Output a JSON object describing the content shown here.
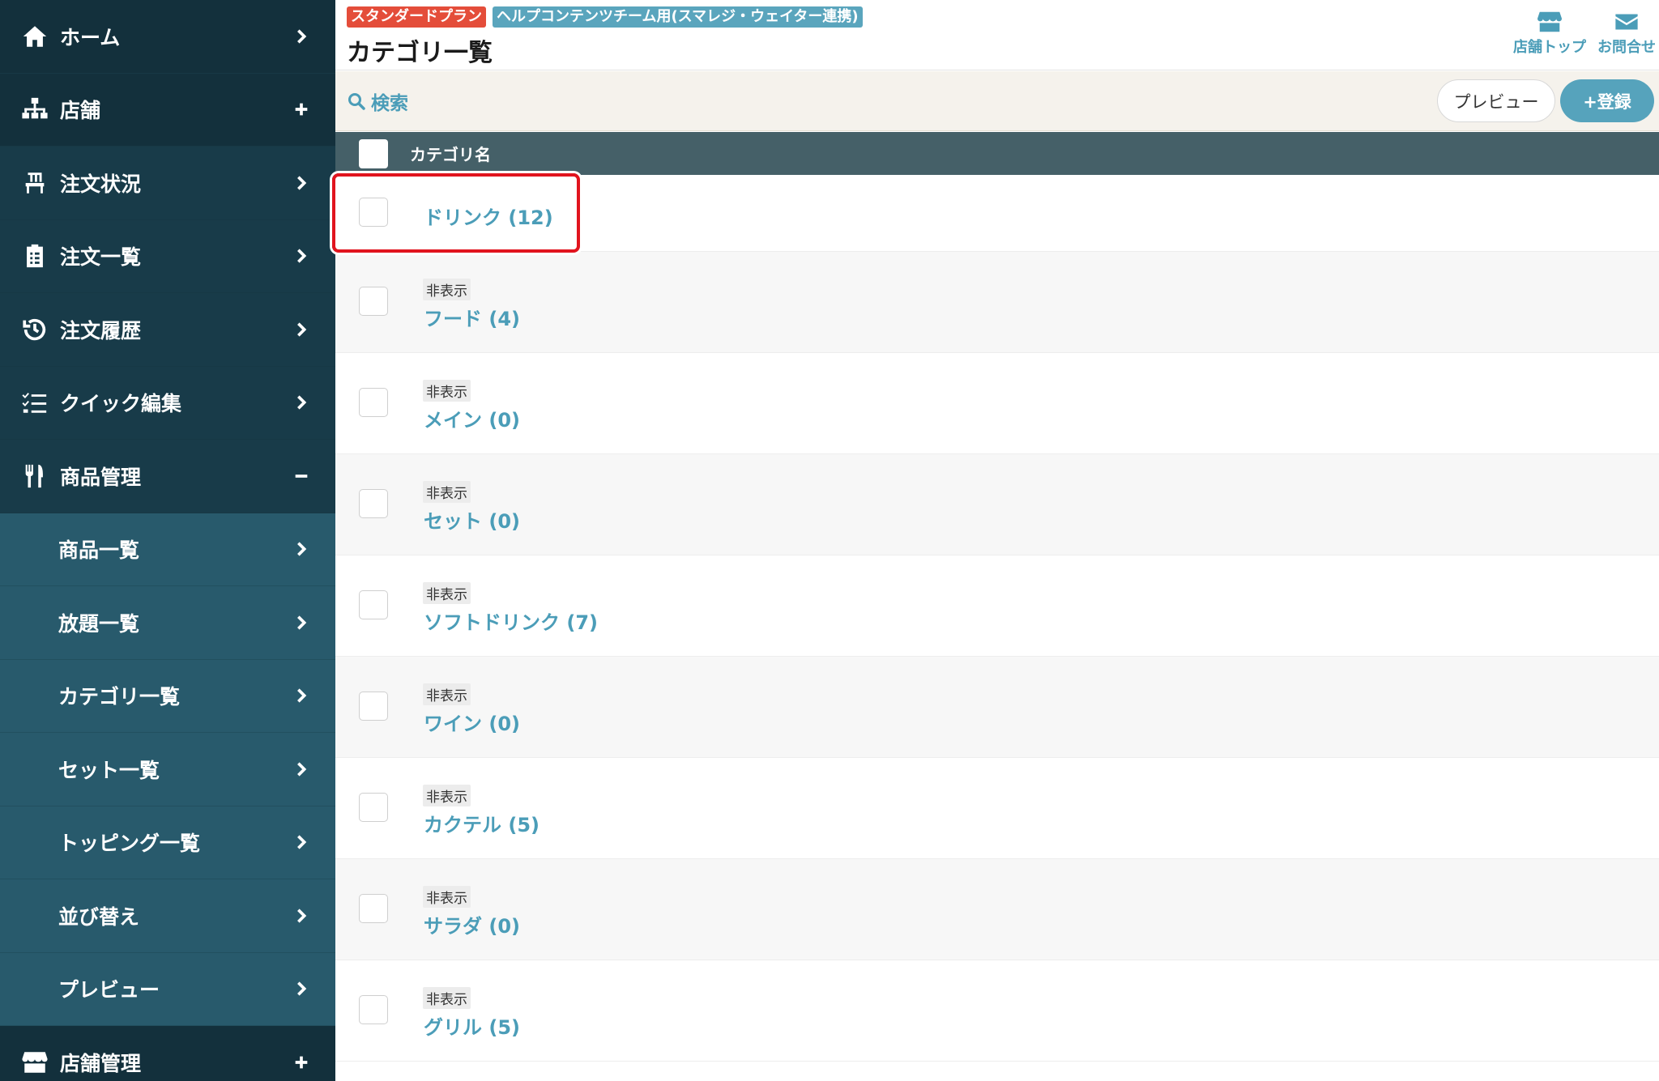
{
  "sidebar": {
    "items": [
      {
        "label": "ホーム",
        "icon": "home-icon",
        "action": ">"
      },
      {
        "label": "店舗",
        "icon": "store-tree-icon",
        "action": "+"
      },
      {
        "label": "注文状況",
        "icon": "chair-icon",
        "action": ">"
      },
      {
        "label": "注文一覧",
        "icon": "clipboard-icon",
        "action": ">"
      },
      {
        "label": "注文履歴",
        "icon": "history-icon",
        "action": ">"
      },
      {
        "label": "クイック編集",
        "icon": "list-check-icon",
        "action": ">"
      },
      {
        "label": "商品管理",
        "icon": "utensils-icon",
        "action": "−"
      }
    ],
    "sub_items": [
      {
        "label": "商品一覧"
      },
      {
        "label": "放題一覧"
      },
      {
        "label": "カテゴリ一覧"
      },
      {
        "label": "セット一覧"
      },
      {
        "label": "トッピング一覧"
      },
      {
        "label": "並び替え"
      },
      {
        "label": "プレビュー"
      }
    ],
    "bottom_item": {
      "label": "店舗管理",
      "icon": "shop-icon",
      "action": "+"
    }
  },
  "header": {
    "plan_badge": "スタンダードプラン",
    "team_badge": "ヘルプコンテンツチーム用(スマレジ・ウェイター連携)",
    "title": "カテゴリ一覧",
    "links": {
      "store_top": "店舗トップ",
      "contact": "お問合せ"
    }
  },
  "searchbar": {
    "search_label": "検索",
    "preview_button": "プレビュー",
    "register_button": "+登録"
  },
  "table": {
    "column_header": "カテゴリ名",
    "rows": [
      {
        "hidden_label": "",
        "name": "ドリンク (12)"
      },
      {
        "hidden_label": "非表示",
        "name": "フード (4)"
      },
      {
        "hidden_label": "非表示",
        "name": "メイン (0)"
      },
      {
        "hidden_label": "非表示",
        "name": "セット (0)"
      },
      {
        "hidden_label": "非表示",
        "name": "ソフトドリンク (7)"
      },
      {
        "hidden_label": "非表示",
        "name": "ワイン (0)"
      },
      {
        "hidden_label": "非表示",
        "name": "カクテル (5)"
      },
      {
        "hidden_label": "非表示",
        "name": "サラダ (0)"
      },
      {
        "hidden_label": "非表示",
        "name": "グリル (5)"
      }
    ]
  },
  "colors": {
    "sidebar_bg": "#1f4554",
    "sidebar_sub_bg": "#285a6c",
    "accent": "#4b9db8",
    "plan_badge": "#e44d3a",
    "highlight": "#e1141e"
  }
}
